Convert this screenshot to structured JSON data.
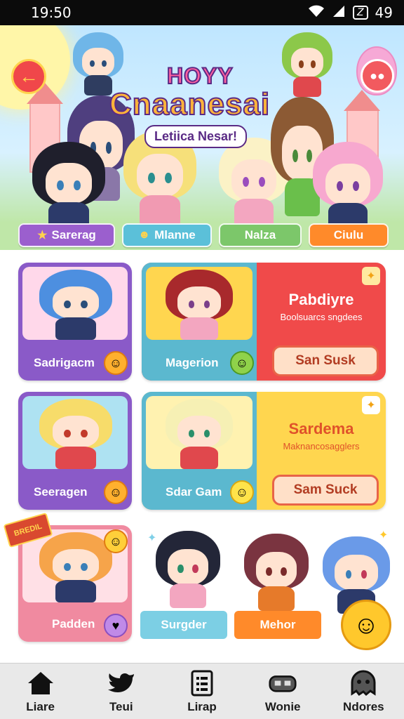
{
  "status_bar": {
    "time": "19:50",
    "battery_label": "49"
  },
  "header": {
    "title_small": "HOYY",
    "title_big": "Cnaanesai",
    "subtitle": "Letiica Nesar!"
  },
  "tabs": [
    {
      "label": "Sarerag",
      "color": "#9b5fce"
    },
    {
      "label": "Mlanne",
      "color": "#5bc0d9"
    },
    {
      "label": "Nalza",
      "color": "#7cc76a"
    },
    {
      "label": "Ciulu",
      "color": "#ff8a2a"
    }
  ],
  "cards": {
    "row1_left": {
      "label": "Sadrigacm"
    },
    "row1_promo": {
      "left_label": "Magerion",
      "title": "Pabdiyre",
      "subtitle": "Boolsuarcs sngdees",
      "button": "San Susk"
    },
    "row2_left": {
      "label": "Seeragen"
    },
    "row2_promo": {
      "left_label": "Sdar Gam",
      "title": "Sardema",
      "subtitle": "Maknancosagglers",
      "button": "Sam Suck"
    },
    "row3_left": {
      "label": "Padden",
      "tag": "BREDIL"
    },
    "row3_free": [
      {
        "label": "Surgder"
      },
      {
        "label": "Mehor"
      }
    ]
  },
  "nav": [
    {
      "label": "Liare",
      "icon": "home-icon"
    },
    {
      "label": "Teui",
      "icon": "bird-icon"
    },
    {
      "label": "Lirap",
      "icon": "list-icon"
    },
    {
      "label": "Wonie",
      "icon": "gamepad-icon"
    },
    {
      "label": "Ndores",
      "icon": "ghost-icon"
    }
  ],
  "colors": {
    "purple": "#9b5fce",
    "teal": "#5bc0d9",
    "green": "#7cc76a",
    "orange": "#ff8a2a",
    "red": "#f04a4a",
    "yellow": "#ffd64f",
    "pink": "#f08aa0"
  }
}
